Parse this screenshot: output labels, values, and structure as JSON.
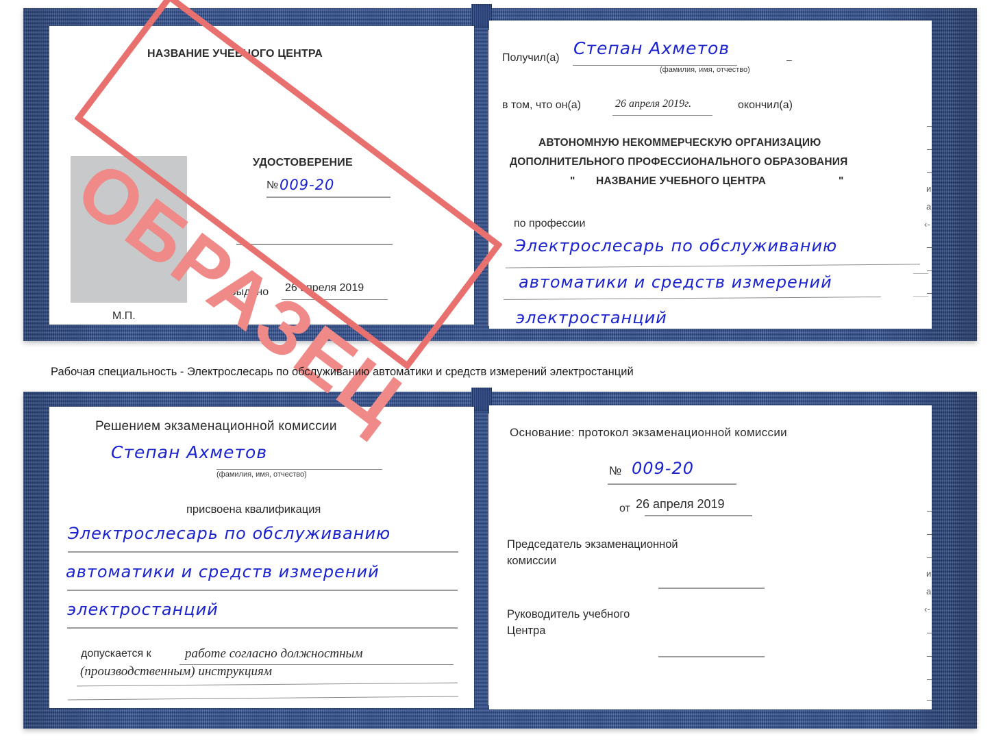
{
  "colors": {
    "cover": "#2e4d8e",
    "paper": "#ffffff",
    "handwriting": "#1a23cf",
    "watermark": "#e8706e",
    "photo_placeholder": "#c7c9cb",
    "rule": "#8b8b8b"
  },
  "watermark": {
    "text": "ОБРАЗЕЦ"
  },
  "caption": {
    "line1": "Рабочая специальность - Электрослесарь по обслуживанию автоматики и средств измерений",
    "line2": "электростанций"
  },
  "certificate_top": {
    "left_page": {
      "center_name": "НАЗВАНИЕ УЧЕБНОГО ЦЕНТРА",
      "doc_title": "УДОСТОВЕРЕНИЕ",
      "number_label": "№",
      "number_value": "009-20",
      "issued_label": "Выдано",
      "issued_value": "26 апреля 2019",
      "stamp_label": "М.П.",
      "photo_alt": "photo-placeholder"
    },
    "right_page": {
      "received_label": "Получил(а)",
      "received_value": "Степан Ахметов",
      "fio_hint": "(фамилия, имя, отчество)",
      "that_he_label": "в том, что он(а)",
      "completion_date": "26 апреля 2019г.",
      "graduated_label": "окончил(а)",
      "org_line1": "АВТОНОМНУЮ НЕКОММЕРЧЕСКУЮ ОРГАНИЗАЦИЮ",
      "org_line2": "ДОПОЛНИТЕЛЬНОГО ПРОФЕССИОНАЛЬНОГО ОБРАЗОВАНИЯ",
      "org_quote_open": "\"",
      "org_line3": "НАЗВАНИЕ УЧЕБНОГО ЦЕНТРА",
      "org_quote_close": "\"",
      "profession_label": "по профессии",
      "profession_line1": "Электрослесарь по обслуживанию",
      "profession_line2": "автоматики и средств измерений",
      "profession_line3": "электростанций",
      "edge_fragments": [
        "–",
        "–",
        "–",
        "и",
        "а",
        "‹-",
        "–",
        "–",
        "–"
      ]
    }
  },
  "certificate_bottom": {
    "left_page": {
      "heading": "Решением экзаменационной комиссии",
      "name_value": "Степан Ахметов",
      "fio_hint": "(фамилия, имя, отчество)",
      "qualification_label": "присвоена квалификация",
      "qualification_line1": "Электрослесарь по обслуживанию",
      "qualification_line2": "автоматики и средств измерений",
      "qualification_line3": "электростанций",
      "admitted_label": "допускается к",
      "admitted_value_line1": "работе согласно должностным",
      "admitted_value_line2": "(производственным) инструкциям"
    },
    "right_page": {
      "basis_label": "Основание: протокол экзаменационной комиссии",
      "number_label": "№",
      "number_value": "009-20",
      "date_label": "от",
      "date_value": "26 апреля 2019",
      "chairman_line1": "Председатель экзаменационной",
      "chairman_line2": "комиссии",
      "head_line1": "Руководитель учебного",
      "head_line2": "Центра",
      "edge_fragments": [
        "–",
        "–",
        "–",
        "и",
        "а",
        "‹-",
        "–",
        "–",
        "–",
        "–"
      ]
    }
  }
}
